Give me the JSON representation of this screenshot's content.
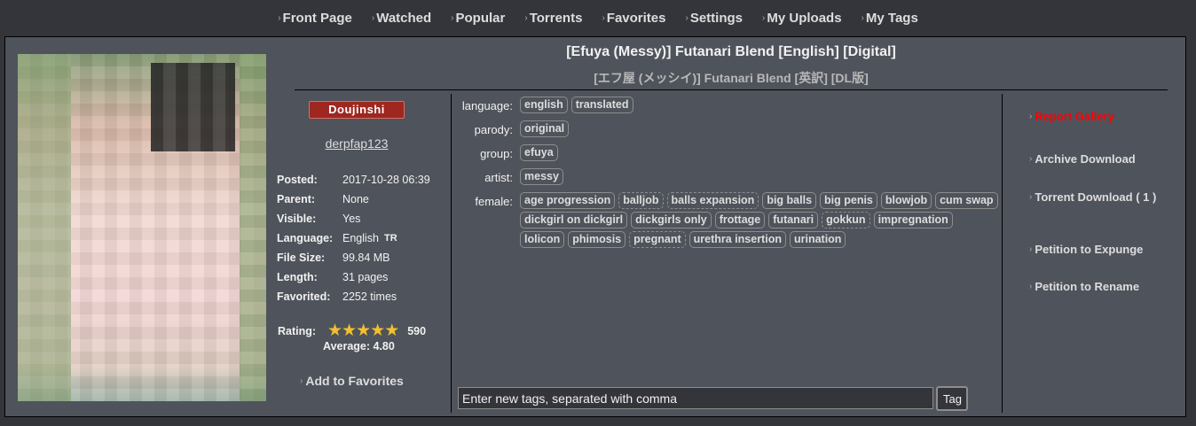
{
  "nav": [
    "Front Page",
    "Watched",
    "Popular",
    "Torrents",
    "Favorites",
    "Settings",
    "My Uploads",
    "My Tags"
  ],
  "gallery": {
    "title": "[Efuya (Messy)] Futanari Blend [English] [Digital]",
    "title_jp": "[エフ屋 (メッシイ)] Futanari Blend [英訳] [DL版]",
    "category": "Doujinshi",
    "category_color": "#9e2720",
    "uploader": "derpfap123"
  },
  "meta": [
    {
      "key": "Posted:",
      "value": "2017-10-28 06:39"
    },
    {
      "key": "Parent:",
      "value": "None"
    },
    {
      "key": "Visible:",
      "value": "Yes"
    },
    {
      "key": "Language:",
      "value": "English",
      "extra": "TR"
    },
    {
      "key": "File Size:",
      "value": "99.84 MB"
    },
    {
      "key": "Length:",
      "value": "31 pages"
    },
    {
      "key": "Favorited:",
      "value": "2252 times"
    }
  ],
  "rating": {
    "label": "Rating:",
    "stars": 5,
    "count": "590",
    "average": "Average: 4.80"
  },
  "add_favorites": "Add to Favorites",
  "tags": [
    {
      "ns": "language:",
      "tags": [
        {
          "t": "english"
        },
        {
          "t": "translated"
        }
      ]
    },
    {
      "ns": "parody:",
      "tags": [
        {
          "t": "original"
        }
      ]
    },
    {
      "ns": "group:",
      "tags": [
        {
          "t": "efuya"
        }
      ]
    },
    {
      "ns": "artist:",
      "tags": [
        {
          "t": "messy"
        }
      ]
    },
    {
      "ns": "female:",
      "tags": [
        {
          "t": "age progression"
        },
        {
          "t": "balljob",
          "dash": true
        },
        {
          "t": "balls expansion",
          "dash": true
        },
        {
          "t": "big balls"
        },
        {
          "t": "big penis"
        },
        {
          "t": "blowjob"
        },
        {
          "t": "cum swap"
        },
        {
          "t": "dickgirl on dickgirl"
        },
        {
          "t": "dickgirls only"
        },
        {
          "t": "frottage"
        },
        {
          "t": "futanari"
        },
        {
          "t": "gokkun",
          "dash": true
        },
        {
          "t": "impregnation"
        },
        {
          "t": "lolicon"
        },
        {
          "t": "phimosis"
        },
        {
          "t": "pregnant",
          "dash": true
        },
        {
          "t": "urethra insertion"
        },
        {
          "t": "urination"
        }
      ]
    }
  ],
  "new_tag": {
    "placeholder": "Enter new tags, separated with comma",
    "button": "Tag"
  },
  "actions": [
    {
      "label": "Report Gallery",
      "color": "#ff0000"
    },
    {
      "label": "Archive Download"
    },
    {
      "label": "Torrent Download ( 1 )"
    },
    {
      "label": "Petition to Expunge"
    },
    {
      "label": "Petition to Rename"
    }
  ]
}
